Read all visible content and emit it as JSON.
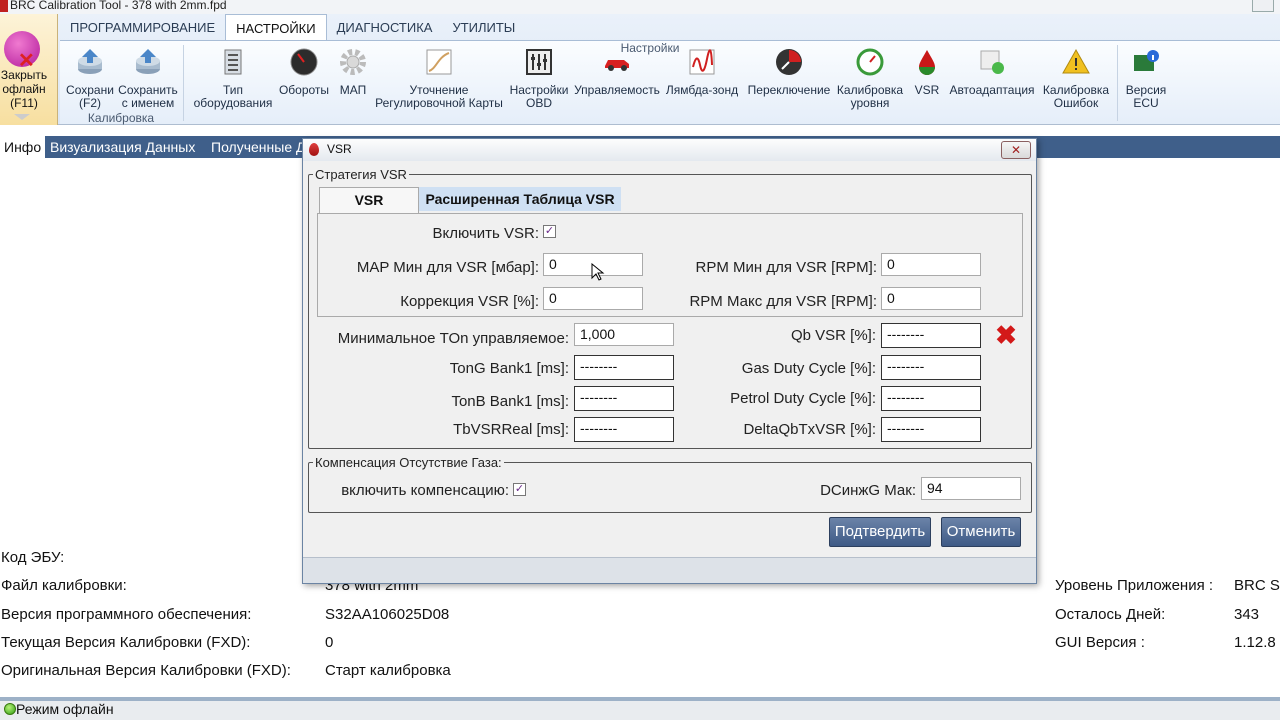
{
  "app": {
    "title": "BRC Calibration Tool   - 378 with 2mm.fpd"
  },
  "ribbon": {
    "tabs": [
      "ПРОГРАММИРОВАНИЕ",
      "НАСТРОЙКИ",
      "ДИАГНОСТИКА",
      "УТИЛИТЫ"
    ],
    "active_tab": "НАСТРОЙКИ",
    "close_offline": "Закрыть\nофлайн\n(F11)",
    "groups": {
      "calibration": "Калибровка",
      "settings": "Настройки"
    },
    "buttons": {
      "save": "Сохрани\n(F2)",
      "save_as": "Сохранить\nс именем",
      "equipment": "Тип\nоборудования",
      "rpm": "Обороты",
      "map": "МАП",
      "refine": "Уточнение\nРегулировочной Карты",
      "obd": "Настройки\nOBD",
      "driveability": "Управляемость",
      "lambda": "Лямбда-зонд",
      "switching": "Переключение",
      "level": "Калибровка\nуровня",
      "vsr": "VSR",
      "autoadapt": "Автоадаптация",
      "errors": "Калибровка\nОшибок",
      "ecu_version": "Версия\nECU"
    }
  },
  "subtabs": [
    "Инфо",
    "Визуализация Данных",
    "Полученные Д"
  ],
  "info": {
    "ecu_code_label": "Код ЭБУ:",
    "calib_file_label": "Файл калибровки:",
    "calib_file_value": "378 with 2mm",
    "sw_version_label": "Версия программного обеспечения:",
    "sw_version_value": "S32AA106025D08",
    "cur_fxd_label": "Текущая Версия  Калибровки (FXD):",
    "cur_fxd_value": "0",
    "orig_fxd_label": "Оригинальная Версия  Калибровки (FXD):",
    "orig_fxd_value": "Старт калибровка",
    "app_level_label": "Уровень Приложения :",
    "app_level_value": "BRC S",
    "days_left_label": "Осталось Дней:",
    "days_left_value": "343",
    "gui_version_label": "GUI Версия :",
    "gui_version_value": "1.12.8"
  },
  "status": {
    "mode": "Режим офлайн"
  },
  "dialog": {
    "title": "VSR",
    "close": "✕",
    "strategy_group": "Стратегия VSR",
    "tab_vsr": "VSR",
    "tab_extended": "Расширенная Таблица VSR",
    "enable_vsr_label": "Включить VSR:",
    "enable_vsr_checked": "✓",
    "map_min_label": "MAP Мин для VSR [мбар]:",
    "map_min_value": "0",
    "rpm_min_label": "RPM Мин для VSR [RPM]:",
    "rpm_min_value": "0",
    "correction_label": "Коррекция VSR [%]:",
    "correction_value": "0",
    "rpm_max_label": "RPM Макс для VSR [RPM]:",
    "rpm_max_value": "0",
    "min_ton_label": "Минимальное TOn управляемое:",
    "min_ton_value": "1,000",
    "qb_vsr_label": "Qb VSR [%]:",
    "qb_vsr_value": "--------",
    "tong_label": "TonG Bank1 [ms]:",
    "tong_value": "--------",
    "gas_duty_label": "Gas Duty Cycle [%]:",
    "gas_duty_value": "--------",
    "tonb_label": "TonB Bank1 [ms]:",
    "tonb_value": "--------",
    "petrol_duty_label": "Petrol Duty Cycle [%]:",
    "petrol_duty_value": "--------",
    "tbvsr_label": "TbVSRReal [ms]:",
    "tbvsr_value": "--------",
    "delta_label": "DeltaQbTxVSR [%]:",
    "delta_value": "--------",
    "comp_group": "Компенсация Отсутствие Газа:",
    "comp_enable_label": "включить компенсацию:",
    "comp_enable_checked": "✓",
    "dcinzg_label": "DCинжG Мак:",
    "dcinzg_value": "94",
    "confirm": "Подтвердить",
    "cancel": "Отменить"
  }
}
